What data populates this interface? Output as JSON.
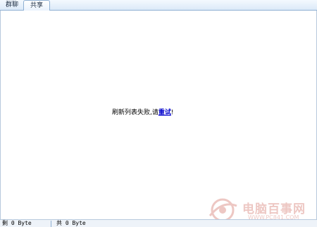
{
  "tabs": {
    "group_chat": "群聊",
    "share": "共享"
  },
  "message": {
    "text": "刷新列表失败,请",
    "retry_link": "重试",
    "suffix": "!"
  },
  "status": {
    "left": "剩 0 Byte",
    "right": "共 0 Byte"
  },
  "watermark": {
    "name": "电脑百事网",
    "url": "WWW.PC841.COM"
  },
  "colors": {
    "link": "#0000cc",
    "tab_border": "#8fb0d3",
    "watermark": "#c0392b"
  }
}
